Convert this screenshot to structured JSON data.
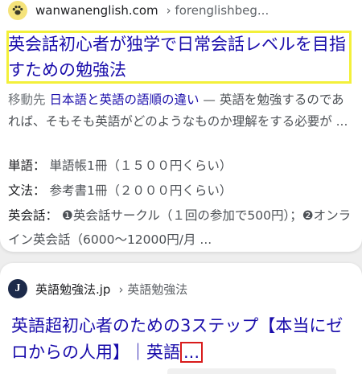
{
  "results": [
    {
      "site_name": "wanwanenglish.com",
      "site_path": "› forenglishbeg...",
      "favicon": "paw-icon",
      "title": "英会話初心者が独学で日常会話レベルを目指すための勉強法",
      "snippet_prefix": "移動先",
      "snippet_anchor": "日本語と英語の語順の違い",
      "snippet_text": " — 英語を勉強するのであれば、そもそも英語がどのようなものか理解をする必要が ...",
      "details": [
        {
          "label": "単語：",
          "value": "単語帳1冊（１５００円くらい）"
        },
        {
          "label": "文法：",
          "value": "参考書1冊（２０００円くらい）"
        },
        {
          "label": "英会話：",
          "value": "❶英会話サークル（１回の参加で500円）；❷オンライン英会話（6000〜12000円/月 ..."
        }
      ]
    },
    {
      "site_name": "英語勉強法.jp",
      "site_path": "› 英語勉強法",
      "favicon_letter": "J",
      "title": "英語超初心者のための3ステップ【本当にゼロからの人用】｜英語",
      "title_ellipsis": "..."
    }
  ],
  "colors": {
    "link": "#1a0dab",
    "highlight": "#f3f03a",
    "marker": "#d81b1b"
  }
}
